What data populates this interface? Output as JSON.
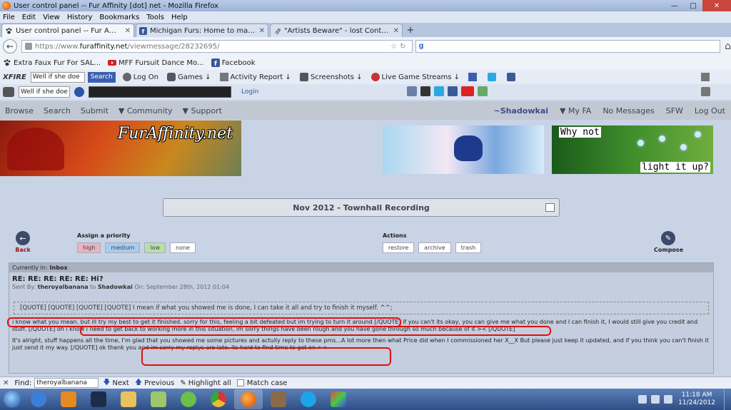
{
  "window": {
    "title": "User control panel -- Fur Affinity [dot] net - Mozilla Firefox"
  },
  "menu": [
    "File",
    "Edit",
    "View",
    "History",
    "Bookmarks",
    "Tools",
    "Help"
  ],
  "tabs": [
    {
      "label": "User control panel -- Fur Affinity [dot]...",
      "active": true
    },
    {
      "label": "Michigan Furs: Home to many, loved...",
      "active": false
    },
    {
      "label": "\"Artists Beware\" - lost Contact, Please...",
      "active": false
    }
  ],
  "nav": {
    "url_prefix": "https://www.",
    "url_domain": "furaffinity.net",
    "url_path": "/viewmessage/28232695/"
  },
  "bookmarks": [
    {
      "label": "Extra Faux Fur For SAL...",
      "icon": "paw-icon"
    },
    {
      "label": "MFF Fursuit Dance Mo...",
      "icon": "youtube-icon"
    },
    {
      "label": "Facebook",
      "icon": "facebook-icon"
    }
  ],
  "xfire": {
    "logo": "XFIRE",
    "select": "Well if she doe",
    "search": "Search",
    "items": [
      "Log On",
      "Games ↓",
      "Activity Report ↓",
      "Screenshots ↓",
      "Live Game Streams ↓"
    ]
  },
  "toolbar3": {
    "select": "Well if she doe",
    "login": "Login"
  },
  "fa_menu": {
    "left": [
      "Browse",
      "Search",
      "Submit",
      "▼ Community",
      "▼ Support"
    ],
    "user": "~Shadowkai",
    "right": [
      "▼ My FA",
      "No Messages",
      "SFW",
      "Log Out"
    ]
  },
  "banner": {
    "logo": "FurAffinity.net"
  },
  "ad2": {
    "line1": "Why not",
    "line2": "light it up?"
  },
  "notice": "Nov 2012 - Townhall Recording",
  "controls": {
    "back": "Back",
    "priority_head": "Assign a priority",
    "priorities": [
      "high",
      "medium",
      "low",
      "none"
    ],
    "actions_head": "Actions",
    "actions": [
      "restore",
      "archive",
      "trash"
    ],
    "compose": "Compose"
  },
  "message": {
    "folder_label": "Currently in:",
    "folder": "Inbox",
    "subject": "RE: RE: RE: RE: RE: Hi?",
    "sent_by_label": "Sent By:",
    "sender": "theroyalbanana",
    "to_label": "to",
    "recipient": "Shadowkai",
    "on_label": "On:",
    "date": "September 28th, 2012 01:04",
    "quote": "[QUOTE] [QUOTE] [QUOTE] [QUOTE] I mean if what you showed me is done, I can take it all and try to finish it myself. ^^;",
    "para1": "i know what you mean. but ill try my best to get it finished. sorry for this, feeling a bit defeated but im trying to turn it around [/QUOTE] if you can't its okay, you can give me what you done and I can finish it, I would still give you credit and stuff. [/QUOTE] oh i know i need to get back to working more in this situation, im sorry things have been rough and you have gone through so much because of it >< [/QUOTE]",
    "para2": "It's alright, stuff happens all the time, I'm glad that you showed me some pictures and actully reply to these pms...A lot more then what Price did when I commissioned her X__X But please just keep it updated, and if you think you can't finish it just send it my way. [/QUOTE] ok thank you and im sorry my replys are late. its hard to find time to get on ><"
  },
  "findbar": {
    "label": "Find:",
    "value": "theroyalbanana",
    "next": "Next",
    "previous": "Previous",
    "highlight": "Highlight all",
    "match_case": "Match case"
  },
  "clock": {
    "time": "11:18 AM",
    "date": "11/24/2012"
  },
  "colors": {
    "fa_bg": "#c8d3e6",
    "annotation": "#e01010",
    "taskbar": "#2e4f86"
  }
}
